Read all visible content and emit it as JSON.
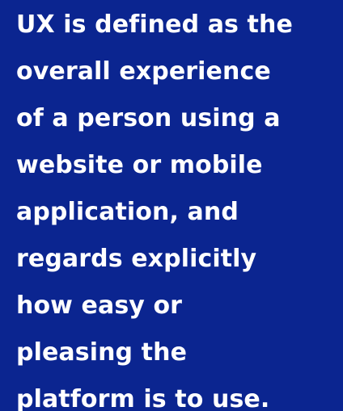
{
  "colors": {
    "background": "#0b2590",
    "text": "#ffffff"
  },
  "quote": {
    "lines": [
      "UX is defined as the",
      "overall experience",
      "of a person using a",
      "website or mobile",
      "application, and",
      "regards explicitly",
      "how easy or",
      "pleasing the",
      "platform is to use."
    ]
  }
}
